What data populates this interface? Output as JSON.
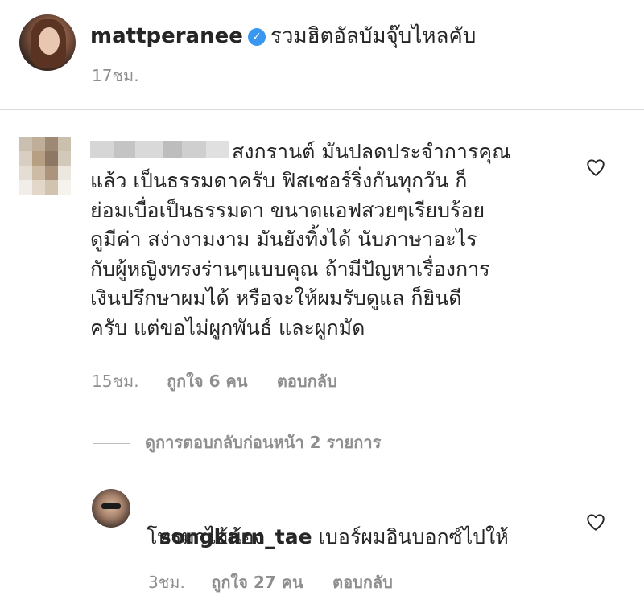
{
  "post": {
    "username": "mattperanee",
    "caption": "รวมฮิตอัลบัมจุ๊บไหลคับ",
    "time": "17ชม."
  },
  "comment": {
    "text_lines": [
      "สงกรานต์ มันปลดประจำการคุณ",
      "แล้ว เป็นธรรมดาครับ ฟิสเชอร์ริ่งกันทุกวัน ก็",
      "ย่อมเบื่อเป็นธรรมดา ขนาดแอฟสวยๆเรียบร้อย",
      "ดูมีค่า สง่างามงาม มันยังทิ้งได้ นับภาษาอะไร",
      "กับผู้หญิงทรงร่านๆแบบคุณ ถ้ามีปัญหาเรื่องการ",
      "เงินปรึกษาผมได้ หรือจะให้ผมรับดูแล ก็ยินดี",
      "ครับ แต่ขอไม่ผูกพันธ์ และผูกมัด"
    ],
    "time": "15ชม.",
    "likes": "ถูกใจ 6 คน",
    "reply_label": "ตอบกลับ"
  },
  "view_replies": "ดูการตอบกลับก่อนหน้า 2 รายการ",
  "reply": {
    "username": "songkarn_tae",
    "text_line1": "เบอร์ผมอินบอกซ์ไปให้",
    "text_line2": "โทรมาไอ้น้อง",
    "time": "3ชม.",
    "likes": "ถูกใจ 27 คน",
    "reply_label": "ตอบกลับ"
  },
  "icons": {
    "verified": "verified-badge-icon",
    "heart": "heart-outline-icon"
  },
  "colors": {
    "verified_blue": "#3897f0",
    "meta_gray": "#8e8e8e",
    "text": "#262626"
  }
}
